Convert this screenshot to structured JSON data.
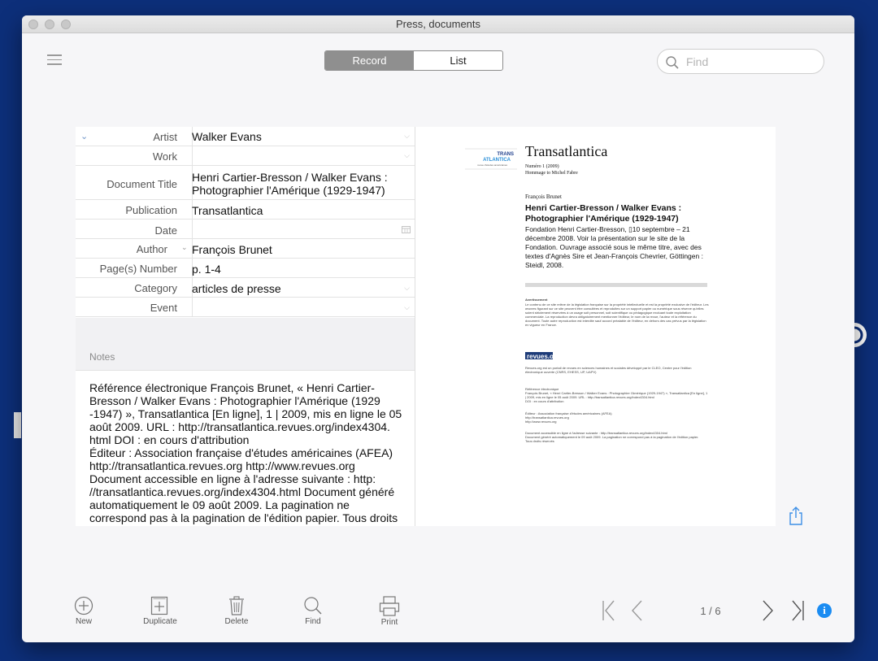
{
  "window": {
    "title": "Press, documents"
  },
  "view_switch": {
    "record_label": "Record",
    "list_label": "List",
    "active": "Record"
  },
  "search": {
    "placeholder": "Find",
    "value": ""
  },
  "fields": [
    {
      "label": "Artist",
      "value": "Walker Evans",
      "control": "dropdown"
    },
    {
      "label": "Work",
      "value": "",
      "control": "dropdown"
    },
    {
      "label": "Document Title",
      "value": "Henri Cartier-Bresson / Walker Evans : Photographier l'Amérique (1929-1947)",
      "control": "none"
    },
    {
      "label": "Publication",
      "value": "Transatlantica",
      "control": "none"
    },
    {
      "label": "Date",
      "value": "",
      "control": "calendar"
    },
    {
      "label": "Author",
      "value": "François Brunet",
      "control": "author-menu"
    },
    {
      "label": "Page(s) Number",
      "value": "p. 1-4",
      "control": "none"
    },
    {
      "label": "Category",
      "value": "articles de presse",
      "control": "dropdown"
    },
    {
      "label": "Event",
      "value": "",
      "control": "dropdown"
    }
  ],
  "notes": {
    "label": "Notes",
    "text": "Référence électronique François Brunet, « Henri Cartier-Bresson / Walker Evans : Photographier l'Amérique (1929 -1947) », Transatlantica [En ligne], 1 | 2009, mis en ligne le 05 août 2009. URL : http://transatlantica.revues.org/index4304. html DOI : en cours d'attribution\nÉditeur : Association française d'études américaines (AFEA) http://transatlantica.revues.org http://www.revues.org\nDocument accessible en ligne à l'adresse suivante : http: //transatlantica.revues.org/index4304.html Document généré automatiquement le 09 août 2009. La pagination ne correspond pas à la pagination de l'édition papier. Tous droits"
  },
  "preview": {
    "logo_top": "TRANS",
    "logo_mid": "ATLANTICA",
    "logo_sub": "revue d'études américaines",
    "journal": "Transatlantica",
    "issue": "Numéro 1  (2009)",
    "homage": "Hommage to Michel Fabre",
    "author": "François Brunet",
    "article_title": "Henri Cartier-Bresson / Walker Evans : Photographier l'Amérique (1929-1947)",
    "article_desc": "Fondation Henri Cartier-Bresson, ▯10 septembre – 21 décembre 2008. Voir la présentation sur le site de la Fondation. Ouvrage associé sous le même titre, avec des textes d'Agnès Sire et Jean-François Chevrier, Göttingen : Steidl, 2008.",
    "warning_title": "Avertissement",
    "warning_text": "Le contenu de ce site relève de la législation française sur la propriété intellectuelle et est la propriété exclusive de l'éditeur. Les œuvres figurant sur ce site peuvent être consultées et reproduites sur un support papier ou numérique sous réserve qu'elles soient strictement réservées à un usage soit personnel, soit scientifique ou pédagogique excluant toute exploitation commerciale. La reproduction devra obligatoirement mentionner l'éditeur, le nom de la revue, l'auteur et la référence du document. Toute autre reproduction est interdite sauf accord préalable de l'éditeur, en dehors des cas prévus par la législation en vigueur en France.",
    "revues_logo": "revues.org",
    "revues_text": "Revues.org est un portail de revues en sciences humaines et sociales développé par le CLEO, Centre pour l'édition électronique ouverte (CNRS, EHESS, UP, UAPV)",
    "ref_text": "Référence électronique\nFrançois Brunet, « Henri Cartier-Bresson / Walker Evans : Photographier l'Amérique (1929-1947) », Transatlantica [En ligne], 1 | 2009, mis en ligne le 05 août 2009. URL : http://transatlantica.revues.org/index4304.html\nDOI : en cours d'attribution",
    "editor_text": "Éditeur : Association française d'études américaines (AFEA)\nhttp://transatlantica.revues.org\nhttp://www.revues.org",
    "doc_text": "Document accessible en ligne à l'adresse suivante : http://transatlantica.revues.org/index4304.html\nDocument généré automatiquement le 09 août 2009. La pagination ne correspond pas à la pagination de l'édition papier.\nTous droits réservés"
  },
  "toolbar": {
    "new": "New",
    "duplicate": "Duplicate",
    "delete": "Delete",
    "find": "Find",
    "print": "Print"
  },
  "pager": {
    "current": 1,
    "total": 6,
    "label": "1 / 6"
  },
  "icons": {
    "menu": "hamburger-icon",
    "search": "magnifier-icon",
    "share": "share-icon",
    "info": "info-icon",
    "calendar": "calendar-icon"
  },
  "colors": {
    "desktop": "#0d2f7a",
    "accent": "#1b8cf2",
    "segment_active": "#8f8f8f"
  }
}
